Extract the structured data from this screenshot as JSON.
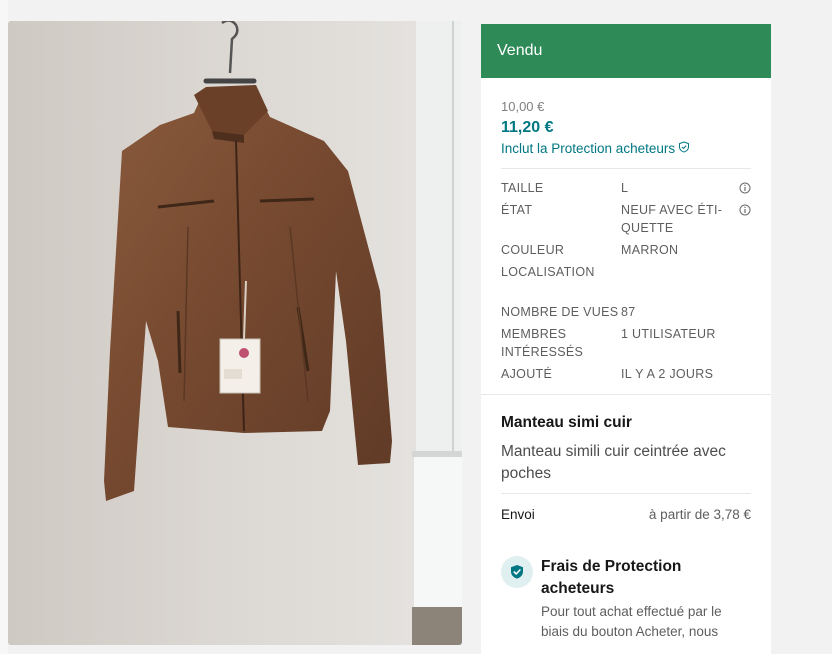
{
  "photo": {
    "alt": "Brown faux-leather jacket on a hanger"
  },
  "panel": {
    "status": "Vendu",
    "price_original": "10,00 €",
    "price_total": "11,20 €",
    "protection_line": "Inclut la Protection acheteurs",
    "details": [
      {
        "label": "TAILLE",
        "value": "L",
        "info": true
      },
      {
        "label": "ÉTAT",
        "value": "NEUF AVEC ÉTI-\nQUETTE",
        "info": true
      },
      {
        "label": "COULEUR",
        "value": "MARRON",
        "info": false
      },
      {
        "label": "LOCALISATION",
        "value": "",
        "info": false
      },
      {
        "label": "NOMBRE DE VUES",
        "value": "87",
        "info": false
      },
      {
        "label": "MEMBRES\nINTÉRESSÉS",
        "value": "1 UTILISATEUR",
        "info": false
      },
      {
        "label": "AJOUTÉ",
        "value": "IL Y A 2 JOURS",
        "info": false
      }
    ],
    "title": "Manteau simi cuir",
    "description": "Manteau simili cuir ceintrée avec poches",
    "shipping_label": "Envoi",
    "shipping_value": "à partir de 3,78 €",
    "fees_title": "Frais de Protection acheteurs",
    "fees_text": "Pour tout achat effectué par le biais du bouton Acheter, nous"
  },
  "colors": {
    "sold_banner": "#2e8a57",
    "accent_teal": "#007782",
    "jacket": "#7a4d33"
  },
  "icons": {
    "info": "info-circle-icon",
    "shield": "shield-check-icon"
  }
}
